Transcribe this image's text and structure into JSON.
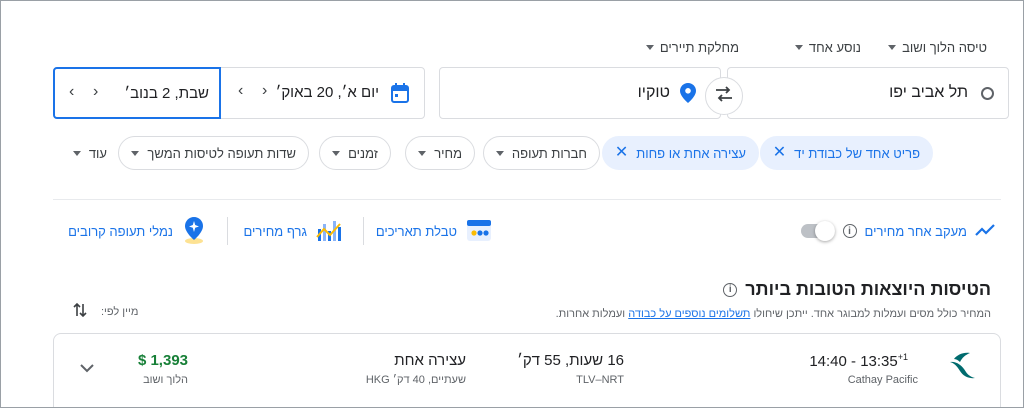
{
  "top_selectors": {
    "trip_type": "טיסה הלוך ושוב",
    "passengers": "נוסע אחד",
    "cabin_class": "מחלקת תיירים"
  },
  "search": {
    "origin": "תל אביב יפו",
    "destination": "טוקיו",
    "depart_date": "יום א׳, 20 באוק׳",
    "return_date": "שבת, 2 בנוב׳"
  },
  "filters": [
    {
      "label": "פריט אחד של כבודת יד",
      "active": true
    },
    {
      "label": "עצירה אחת או פחות",
      "active": true
    },
    {
      "label": "חברות תעופה",
      "active": false
    },
    {
      "label": "מחיר",
      "active": false
    },
    {
      "label": "זמנים",
      "active": false
    },
    {
      "label": "שדות תעופה לטיסות המשך",
      "active": false
    },
    {
      "label": "עוד",
      "active": false
    }
  ],
  "tools": {
    "track_prices": "מעקב אחר מחירים",
    "date_grid": "טבלת תאריכים",
    "price_graph": "גרף מחירים",
    "nearby_airports": "נמלי תעופה קרובים"
  },
  "results": {
    "title": "הטיסות היוצאות הטובות ביותר",
    "subtitle_prefix": "המחיר כולל מסים ועמלות למבוגר אחד. ייתכן שיחולו ",
    "subtitle_link": "תשלומים נוספים על כבודה",
    "subtitle_suffix": " ועמלות אחרות.",
    "sort_label": "מיין לפי:"
  },
  "flight": {
    "times": "14:40 - 13:35",
    "plus_day": "+1",
    "airline": "Cathay Pacific",
    "duration": "16 שעות, 55 דק׳",
    "route": "TLV–NRT",
    "stops": "עצירה אחת",
    "layover": "שעתיים, 40 דק׳ HKG",
    "price": "‎$ 1,393",
    "price_type": "הלוך ושוב"
  },
  "colors": {
    "accent": "#1a73e8",
    "price_green": "#188038",
    "chip_active_bg": "#e8f0fe",
    "airline_teal": "#006b6e"
  }
}
